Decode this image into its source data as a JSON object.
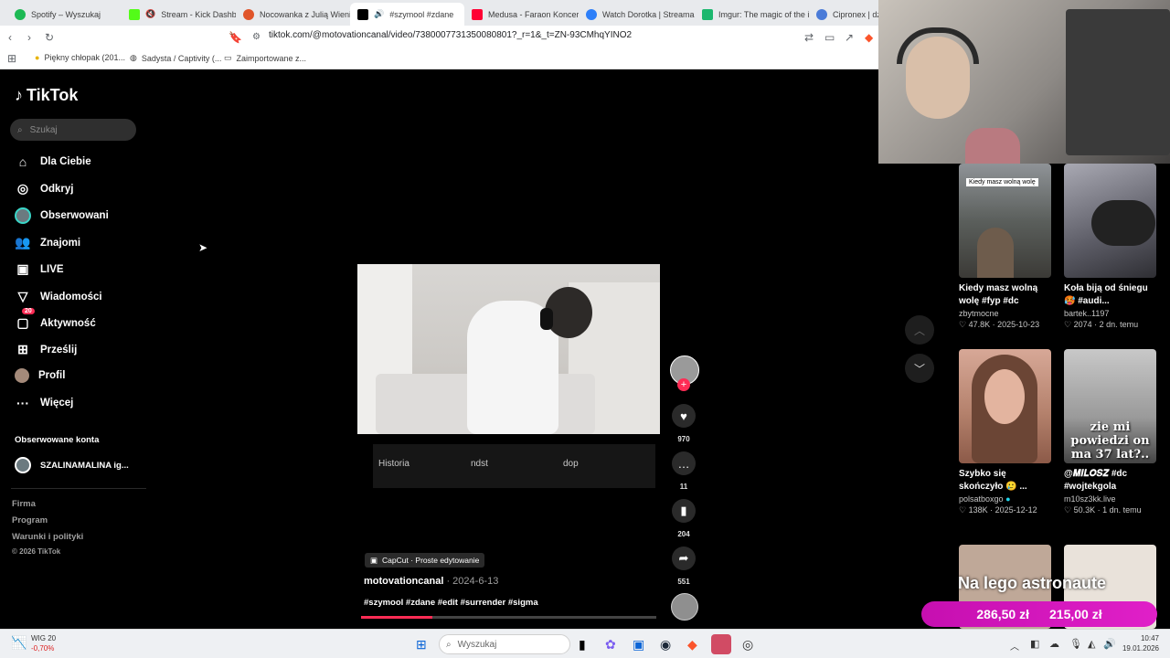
{
  "tabs": [
    {
      "label": "Spotify – Wyszukaj",
      "color": "#1db954"
    },
    {
      "label": "Stream - Kick Dashbo",
      "color": "#53fc18"
    },
    {
      "label": "Nocowanka z Julią Wienia",
      "color": "#e0552a"
    },
    {
      "label": "#szymool #zdane",
      "color": "#000000"
    },
    {
      "label": "Medusa - Faraon Koncert",
      "color": "#ff0033"
    },
    {
      "label": "Watch Dorotka | Streamal",
      "color": "#2d7ff9"
    },
    {
      "label": "Imgur: The magic of the i",
      "color": "#1bb76e"
    },
    {
      "label": "Cipronex | dzi",
      "color": "#4a7bd8"
    }
  ],
  "toolbar": {
    "url": "tiktok.com/@motovationcanal/video/7380007731350080801?_r=1&_t=ZN-93CMhqYINO2"
  },
  "bookmarks": [
    {
      "label": "Piękny chłopak (201..."
    },
    {
      "label": "Sadysta / Captivity (..."
    },
    {
      "label": "Zaimportowane z..."
    }
  ],
  "sidebar": {
    "logo": "TikTok",
    "search_placeholder": "Szukaj",
    "nav": [
      {
        "label": "Dla Ciebie",
        "icon": "home-icon"
      },
      {
        "label": "Odkryj",
        "icon": "compass-icon"
      },
      {
        "label": "Obserwowani",
        "icon": "avatar-icon"
      },
      {
        "label": "Znajomi",
        "icon": "friends-icon"
      },
      {
        "label": "LIVE",
        "icon": "live-icon"
      },
      {
        "label": "Wiadomości",
        "icon": "send-icon"
      },
      {
        "label": "Aktywność",
        "icon": "activity-icon",
        "badge": "20"
      },
      {
        "label": "Prześlij",
        "icon": "upload-icon"
      },
      {
        "label": "Profil",
        "icon": "profile-icon"
      },
      {
        "label": "Więcej",
        "icon": "more-icon"
      }
    ],
    "followed_heading": "Obserwowane konta",
    "followed_account": "SZALINAMALINA ig...",
    "footer": [
      "Firma",
      "Program",
      "Warunki i polityki",
      "© 2026 TikTok"
    ]
  },
  "video": {
    "menu": [
      "Historia",
      "ndst",
      "dop"
    ],
    "likes": "970",
    "comments": "11",
    "saves": "204",
    "shares": "551",
    "capcut": "CapCut · Proste edytowanie",
    "author": "motovationcanal",
    "date": " · 2024-6-13",
    "tags": "#szymool #zdane #edit #surrender #sigma",
    "progress": 0.24
  },
  "recommended": [
    {
      "title": "Kiedy masz wolną wolę #fyp #dc",
      "user": "zbytmocne",
      "stats": "♡ 47.8K · 2025-10-23",
      "overlay": "Kiedy masz wolną wolę"
    },
    {
      "title": "Koła biją od śniegu 🥵 #audi...",
      "user": "bartek..1197",
      "stats": "♡ 2074 · 2 dn. temu",
      "overlay": ""
    },
    {
      "title": "Szybko się skończyło 🥲 ...",
      "user": "polsatboxgo",
      "stats": "♡ 138K · 2025-12-12",
      "overlay": ""
    },
    {
      "title": "@𝑴𝑰𝑳𝑶𝑺𝒁 #dc #wojtekgola",
      "user": "m10sz3kk.live",
      "stats": "♡ 50.3K · 1 dn. temu",
      "overlay": "zie mi powiedzi on ma 37 lat?.."
    }
  ],
  "donation": {
    "headline": "Na lego astronaute",
    "current": "286,50 zł",
    "goal": "215,00 zł"
  },
  "taskbar": {
    "stock_name": "WIG 20",
    "stock_change": "-0,70%",
    "search": "Wyszukaj",
    "time": "10:47",
    "date": "19.01.2026"
  }
}
